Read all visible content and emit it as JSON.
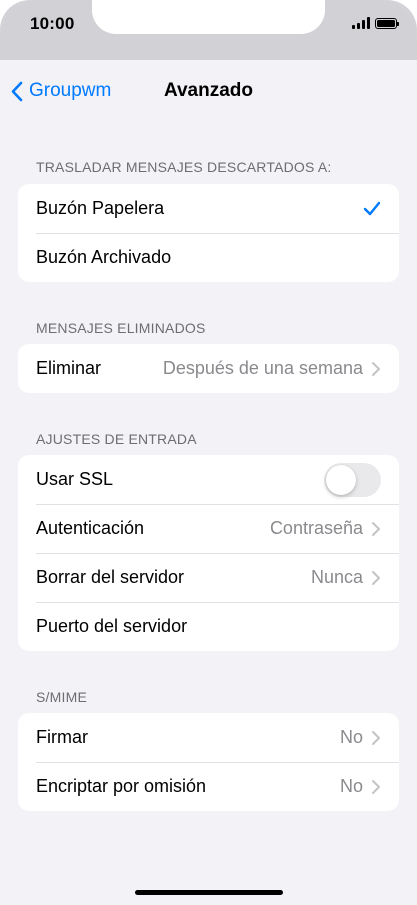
{
  "status_bar": {
    "time": "10:00",
    "signal_icon": "cellular-signal-icon",
    "battery_icon": "battery-icon"
  },
  "nav": {
    "back_label": "Groupwm",
    "back_icon": "chevron-left-icon",
    "title": "Avanzado",
    "accent_color": "#007aff"
  },
  "sections": {
    "discarded": {
      "header": "TRASLADAR MENSAJES DESCARTADOS A:",
      "items": [
        {
          "label": "Buzón Papelera",
          "selected": true,
          "check_icon": "checkmark-icon"
        },
        {
          "label": "Buzón Archivado",
          "selected": false
        }
      ]
    },
    "deleted": {
      "header": "MENSAJES ELIMINADOS",
      "items": [
        {
          "label": "Eliminar",
          "value": "Después de una semana"
        }
      ]
    },
    "incoming": {
      "header": "AJUSTES DE ENTRADA",
      "items": [
        {
          "label": "Usar SSL",
          "toggle_on": false
        },
        {
          "label": "Autenticación",
          "value": "Contraseña"
        },
        {
          "label": "Borrar del servidor",
          "value": "Nunca"
        },
        {
          "label": "Puerto del servidor",
          "value": ""
        }
      ]
    },
    "smime": {
      "header": "S/MIME",
      "items": [
        {
          "label": "Firmar",
          "value": "No"
        },
        {
          "label": "Encriptar por omisión",
          "value": "No"
        }
      ]
    }
  }
}
